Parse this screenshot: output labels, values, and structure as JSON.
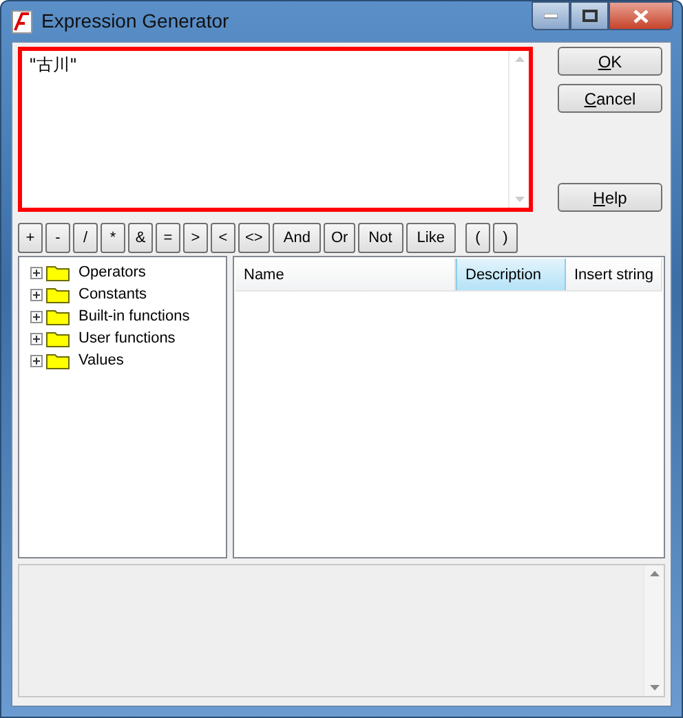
{
  "window": {
    "title": "Expression Generator"
  },
  "expression": {
    "value": "\"古川\""
  },
  "side_buttons": [
    "OK",
    "Cancel",
    "Help"
  ],
  "operators": [
    "+",
    "-",
    "/",
    "*",
    "&",
    "=",
    ">",
    "<",
    "<>",
    "And",
    "Or",
    "Not",
    "Like"
  ],
  "brackets": [
    "(",
    ")"
  ],
  "tree": [
    {
      "label": "Operators",
      "expanded": false
    },
    {
      "label": "Constants",
      "expanded": false
    },
    {
      "label": "Built-in functions",
      "expanded": false
    },
    {
      "label": "User functions",
      "expanded": false
    },
    {
      "label": "Values",
      "expanded": false
    }
  ],
  "table": {
    "columns": [
      {
        "label": "Name",
        "selected": false
      },
      {
        "label": "Description",
        "selected": true
      },
      {
        "label": "Insert string",
        "selected": false
      }
    ]
  }
}
